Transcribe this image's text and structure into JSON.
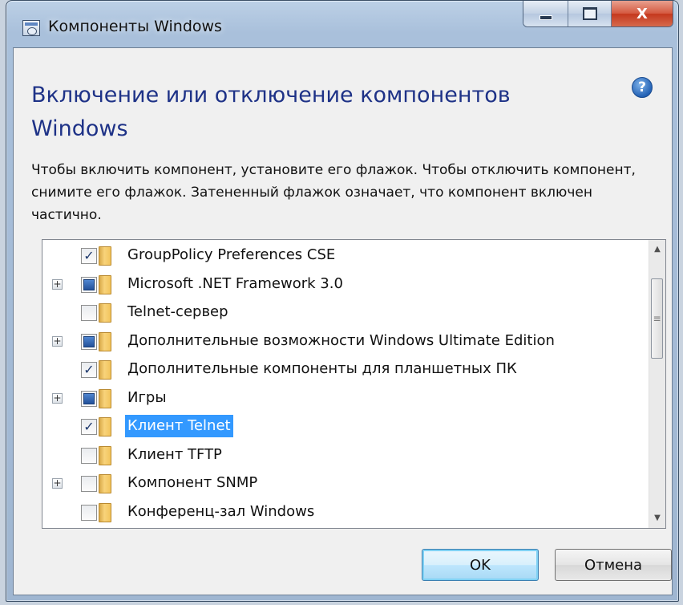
{
  "window": {
    "title": "Компоненты Windows",
    "caption": {
      "minimize": "minimize-icon",
      "maximize": "maximize-icon",
      "close": "close-icon",
      "close_glyph": "X"
    }
  },
  "header": {
    "heading": "Включение или отключение компонентов Windows",
    "help_glyph": "?"
  },
  "description": "Чтобы включить компонент, установите его флажок. Чтобы отключить компонент, снимите его флажок. Затененный флажок означает, что компонент включен частично.",
  "features": [
    {
      "label": "GroupPolicy Preferences CSE",
      "state": "checked",
      "expandable": false,
      "selected": false
    },
    {
      "label": "Microsoft .NET Framework 3.0",
      "state": "partial",
      "expandable": true,
      "selected": false
    },
    {
      "label": "Telnet-сервер",
      "state": "unchecked",
      "expandable": false,
      "selected": false
    },
    {
      "label": "Дополнительные возможности Windows Ultimate Edition",
      "state": "partial",
      "expandable": true,
      "selected": false
    },
    {
      "label": "Дополнительные компоненты для планшетных ПК",
      "state": "checked",
      "expandable": false,
      "selected": false
    },
    {
      "label": "Игры",
      "state": "partial",
      "expandable": true,
      "selected": false
    },
    {
      "label": "Клиент Telnet",
      "state": "checked",
      "expandable": false,
      "selected": true
    },
    {
      "label": "Клиент TFTP",
      "state": "unchecked",
      "expandable": false,
      "selected": false
    },
    {
      "label": "Компонент SNMP",
      "state": "unchecked",
      "expandable": true,
      "selected": false
    },
    {
      "label": "Конференц-зал Windows",
      "state": "unchecked",
      "expandable": false,
      "selected": false
    }
  ],
  "buttons": {
    "ok": "OK",
    "cancel": "Отмена"
  },
  "colors": {
    "heading": "#1e3287",
    "selection": "#3399ff"
  }
}
